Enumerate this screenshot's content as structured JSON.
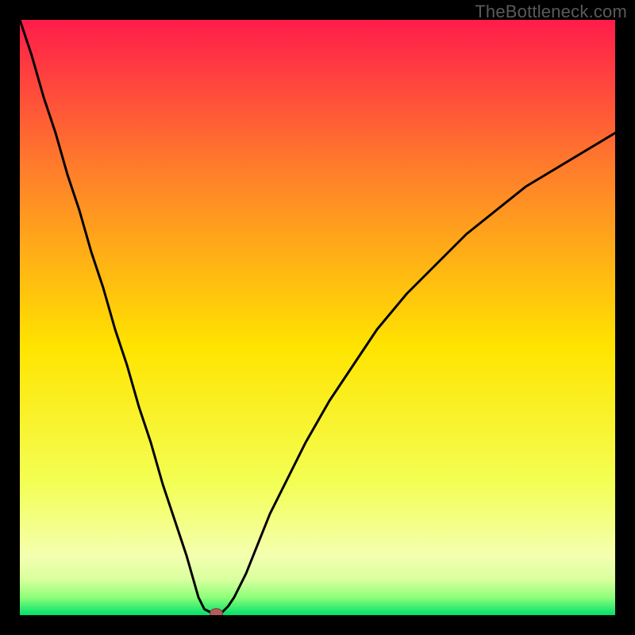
{
  "watermark": "TheBottleneck.com",
  "colors": {
    "frame": "#000000",
    "curve": "#000000",
    "marker_fill": "#b55c5c",
    "marker_stroke": "#6f3a3a",
    "grad_top": "#ff1c4b",
    "grad_q1": "#ff7d2b",
    "grad_mid": "#ffe400",
    "grad_q3": "#f3ff55",
    "grad_band1": "#f4ffb0",
    "grad_band2": "#d9ff9e",
    "grad_band3": "#8eff7a",
    "grad_bottom": "#00e06a"
  },
  "chart_data": {
    "type": "line",
    "title": "",
    "xlabel": "",
    "ylabel": "",
    "xlim": [
      0,
      100
    ],
    "ylim": [
      0,
      100
    ],
    "series": [
      {
        "name": "curve",
        "x": [
          0,
          2,
          4,
          6,
          8,
          10,
          12,
          14,
          16,
          18,
          20,
          22,
          24,
          26,
          28,
          30,
          31,
          32,
          33,
          34,
          35,
          36,
          38,
          40,
          42,
          45,
          48,
          52,
          56,
          60,
          65,
          70,
          75,
          80,
          85,
          90,
          95,
          100
        ],
        "y": [
          100,
          94,
          87,
          81,
          74,
          68,
          61,
          55,
          48,
          42,
          35,
          29,
          22,
          16,
          10,
          3,
          1,
          0.5,
          0.3,
          0.5,
          1.5,
          3,
          7,
          12,
          17,
          23,
          29,
          36,
          42,
          48,
          54,
          59,
          64,
          68,
          72,
          75,
          78,
          81
        ]
      }
    ],
    "marker": {
      "x": 33,
      "y": 0.3
    }
  }
}
